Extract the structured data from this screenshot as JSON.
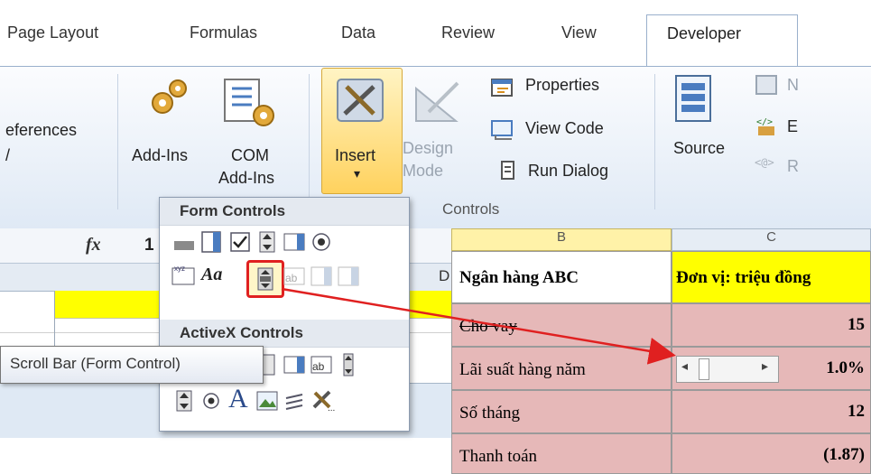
{
  "tabs": {
    "page_layout": "Page Layout",
    "formulas": "Formulas",
    "data": "Data",
    "review": "Review",
    "view": "View",
    "developer": "Developer"
  },
  "ribbon": {
    "references": "eferences",
    "references_sub": "/",
    "add_ins": "Add-Ins",
    "com_1": "COM",
    "com_2": "Add-Ins",
    "insert": "Insert",
    "insert_arrow": "▾",
    "design_1": "Design",
    "design_2": "Mode",
    "properties": "Properties",
    "view_code": "View Code",
    "run_dialog": "Run Dialog",
    "controls_group": "Controls",
    "source": "Source",
    "xml_1": "N",
    "xml_2": "E",
    "xml_3": "R"
  },
  "formula_bar": {
    "fx": "fx",
    "value": "1"
  },
  "sheet_left": {
    "col_d": "D"
  },
  "dropdown": {
    "form_controls": "Form Controls",
    "activex_controls": "ActiveX Controls"
  },
  "tooltip": "Scroll Bar (Form Control)",
  "table": {
    "col_b": "B",
    "col_c": "C",
    "bank": "Ngân hàng ABC",
    "unit": "Đơn vị: triệu đồng",
    "rows": [
      {
        "label": "Cho vay",
        "value": "15"
      },
      {
        "label": "Lãi suất hàng năm",
        "value": "1.0%"
      },
      {
        "label": "Số tháng",
        "value": "12"
      },
      {
        "label": "Thanh toán",
        "value": "(1.87)"
      }
    ]
  },
  "colors": {
    "highlight_red": "#e02020",
    "insert_gold": "#ffd25e",
    "header_yellow": "#ffff00",
    "cell_pink": "#e6b8b8"
  }
}
